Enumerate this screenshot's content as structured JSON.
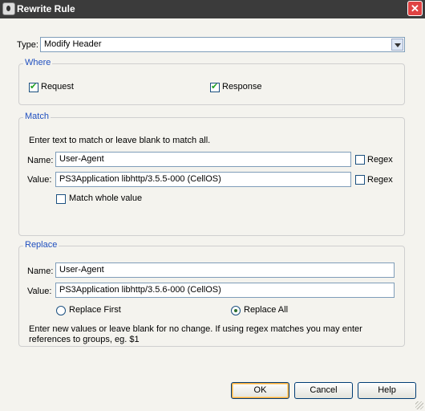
{
  "window": {
    "title": "Rewrite Rule",
    "accent": "#3b3b3b",
    "close_color": "#e04343"
  },
  "type": {
    "label": "Type:",
    "value": "Modify Header"
  },
  "where": {
    "legend": "Where",
    "request": {
      "label": "Request",
      "checked": true
    },
    "response": {
      "label": "Response",
      "checked": true
    }
  },
  "match": {
    "legend": "Match",
    "instructions": "Enter text to match or leave blank to match all.",
    "name_label": "Name:",
    "name_value": "User-Agent",
    "name_regex_label": "Regex",
    "value_label": "Value:",
    "value_value": "PS3Application libhttp/3.5.5-000 (CellOS)",
    "value_regex_label": "Regex",
    "match_whole_label": "Match whole value"
  },
  "replace": {
    "legend": "Replace",
    "name_label": "Name:",
    "name_value": "User-Agent",
    "value_label": "Value:",
    "value_value": "PS3Application libhttp/3.5.6-000 (CellOS)",
    "replace_first_label": "Replace First",
    "replace_all_label": "Replace All",
    "selected": "Replace All",
    "help_line1": "Enter new values or leave blank for no change. If using regex matches you may enter",
    "help_line2": "references to groups, eg. $1"
  },
  "buttons": {
    "ok": "OK",
    "cancel": "Cancel",
    "help": "Help"
  }
}
